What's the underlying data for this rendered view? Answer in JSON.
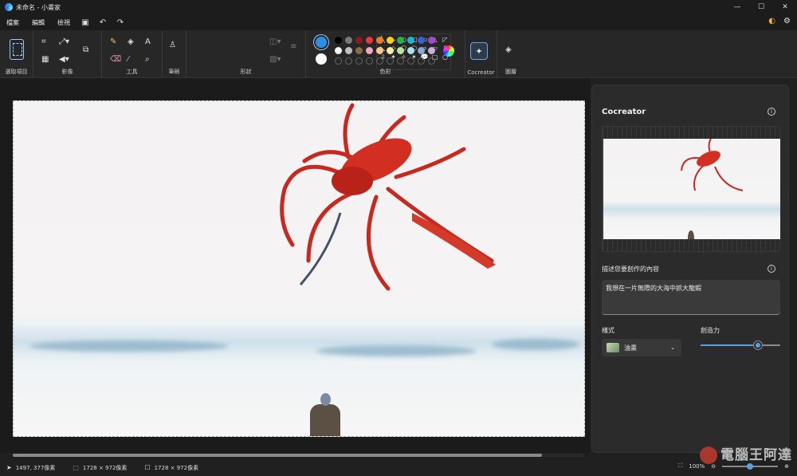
{
  "titlebar": {
    "title": "未命名 - 小畫家",
    "minimize": "—",
    "maximize": "☐",
    "close": "✕"
  },
  "menu": {
    "items": [
      "檔案",
      "編輯",
      "檢視"
    ],
    "save_icon": "save-icon",
    "undo": "↶",
    "redo": "↷"
  },
  "ribbon": {
    "groups": {
      "select": "選取項目",
      "image": "影像",
      "tools": "工具",
      "brushes": "筆刷",
      "shapes": "形狀",
      "colors": "色彩",
      "cocreator": "Cocreator",
      "layers": "圖層"
    },
    "tools_glyphs": {
      "pencil": "✎",
      "fill": "◈",
      "text": "A",
      "eraser": "⌫",
      "picker": "⁄",
      "zoom": "⌕",
      "brush": "🖌"
    },
    "shapes": [
      "╲",
      "∿",
      "○",
      "□",
      "▭",
      "△",
      "◸",
      "◺",
      "◇",
      "⬠",
      "⬡",
      "⇨",
      "⇦",
      "⇧",
      "⇩",
      "✦",
      "✧",
      "✶",
      "💬",
      "▢",
      "○"
    ],
    "colors": {
      "primary": "#2b8fe6",
      "secondary": "#ffffff",
      "row1": [
        "#000000",
        "#7a7a7a",
        "#8b1a1a",
        "#e33c3c",
        "#f07a2a",
        "#f5d020",
        "#2bb04a",
        "#1fb5d8",
        "#3a60d8",
        "#a04ad8"
      ],
      "row2": [
        "#ffffff",
        "#c0c0c0",
        "#8a6a4a",
        "#f2a6c0",
        "#f7c88a",
        "#f7eca0",
        "#b8e6a0",
        "#a8e2f0",
        "#8aa8d8",
        "#c8b0e0"
      ]
    }
  },
  "canvas": {
    "description_alt": ""
  },
  "cocreator": {
    "title": "Cocreator",
    "prompt_label": "描述您要創作的內容",
    "prompt_value": "我想在一片無際的大海中抓大龍蝦",
    "style_label": "樣式",
    "style_value": "油畫",
    "creativity_label": "創造力",
    "creativity_level": 0.72
  },
  "status": {
    "cursor": "1497, 377像素",
    "selection": "1728 × 972像素",
    "canvas_size": "1728 × 972像素",
    "zoom": "100%",
    "zoom_level": 0.5
  },
  "watermark": "電腦王阿達"
}
